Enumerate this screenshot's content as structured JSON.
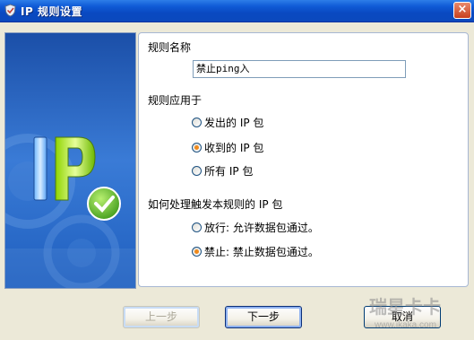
{
  "window": {
    "title": "IP 规则设置",
    "close_label": "×"
  },
  "side_banner": {
    "logo_text": "IP"
  },
  "form": {
    "rule_name_label": "规则名称",
    "rule_name_value": "禁止ping入",
    "apply_label": "规则应用于",
    "apply_options": [
      {
        "label": "发出的 IP 包",
        "selected": false
      },
      {
        "label": "收到的 IP 包",
        "selected": true
      },
      {
        "label": "所有 IP 包",
        "selected": false
      }
    ],
    "action_label": "如何处理触发本规则的 IP 包",
    "action_options": [
      {
        "label": "放行: 允许数据包通过。",
        "selected": false
      },
      {
        "label": "禁止: 禁止数据包通过。",
        "selected": true
      }
    ]
  },
  "buttons": {
    "prev": "上一步",
    "next": "下一步",
    "cancel": "取消"
  },
  "watermark": {
    "text": "瑞星卡卡",
    "url": "www.ikaka.com"
  },
  "colors": {
    "titlebar": "#0a49c1",
    "banner": "#1f5fbf",
    "radio_dot": "#f08a1c"
  }
}
